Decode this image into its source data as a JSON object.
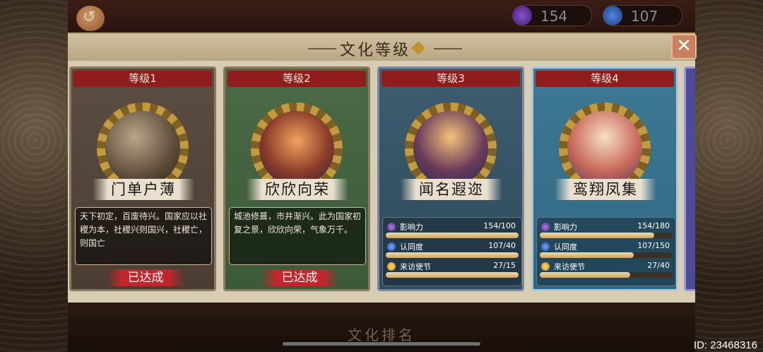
{
  "topbar": {
    "resources": [
      {
        "icon": "influence-coin-icon",
        "value": "154"
      },
      {
        "icon": "recognition-coin-icon",
        "value": "107"
      }
    ]
  },
  "dialog": {
    "title": "文化等级",
    "close_icon": "close-icon"
  },
  "cards": [
    {
      "level": "等级1",
      "name": "门单户薄",
      "description": "天下初定，百废待兴。国家应以社稷为本，社稷兴则国兴，社稷亡，则国亡",
      "status": "已达成"
    },
    {
      "level": "等级2",
      "name": "欣欣向荣",
      "description": "城池修葺，市井渐兴。此为国家初复之景，欣欣向荣，气象万千。",
      "status": "已达成"
    },
    {
      "level": "等级3",
      "name": "闻名遐迩",
      "stats": [
        {
          "label": "影响力",
          "value": "154/100",
          "progress": 1.0
        },
        {
          "label": "认同度",
          "value": "107/40",
          "progress": 1.0
        },
        {
          "label": "来访使节",
          "value": "27/15",
          "progress": 1.0
        }
      ]
    },
    {
      "level": "等级4",
      "name": "鸾翔凤集",
      "stats": [
        {
          "label": "影响力",
          "value": "154/180",
          "progress": 0.86
        },
        {
          "label": "认同度",
          "value": "107/150",
          "progress": 0.71
        },
        {
          "label": "来访使节",
          "value": "27/40",
          "progress": 0.68
        }
      ]
    }
  ],
  "footer": {
    "title": "文化排名"
  },
  "user": {
    "id_text": "ID: 23468316"
  }
}
